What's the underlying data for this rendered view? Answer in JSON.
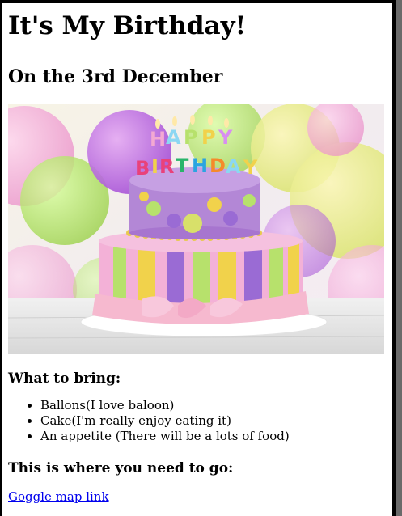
{
  "page": {
    "title": "It's My Birthday!",
    "date_heading": "On the 3rd December"
  },
  "image": {
    "cake_text": "HAPPY BIRTHDAY",
    "colors": {
      "balloon_pink": "#f4a3d6",
      "balloon_yellow": "#f1f27a",
      "balloon_green": "#b8ec73",
      "balloon_purple": "#c16be6",
      "cake_top": "#b387d6",
      "cake_dots": "#d8e06a",
      "stripe_pink": "#f3b1d7",
      "stripe_yellow": "#f1d24b",
      "stripe_green": "#b7e16c",
      "stripe_purple": "#9a6bd4",
      "ribbon_pink": "#f6b9cf"
    }
  },
  "bring": {
    "heading": "What to bring:",
    "items": [
      "Ballons(I love baloon)",
      "Cake(I'm really enjoy eating it)",
      "An appetite (There will be a lots of food)"
    ]
  },
  "location": {
    "heading": "This is where you need to go:",
    "link_text": "Goggle map link"
  }
}
